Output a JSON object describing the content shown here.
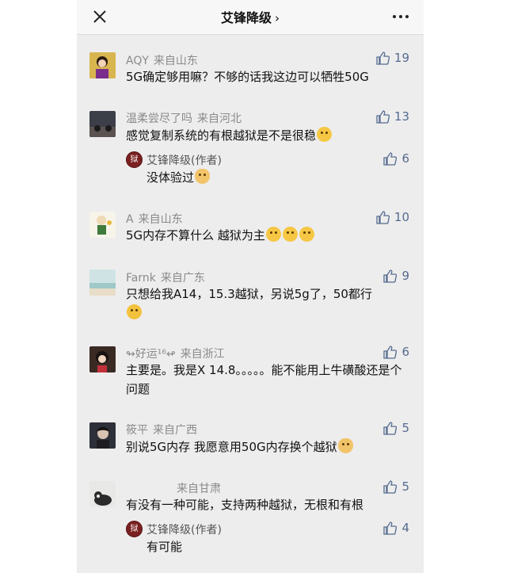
{
  "header": {
    "title": "艾锋降级",
    "chevron": "›"
  },
  "colors": {
    "background": "#ededed",
    "like": "#556b90",
    "meta": "#8a8a8a"
  },
  "comments": [
    {
      "user": "AQY",
      "location": "来自山东",
      "likes": "19",
      "text": "5G确定够用嘛？不够的话我这边可以牺牲50G"
    },
    {
      "user": "温柔尝尽了吗",
      "location": "来自河北",
      "likes": "13",
      "text": "感觉复制系统的有根越狱是不是很稳",
      "reply": {
        "user": "艾锋降级(作者)",
        "likes": "6",
        "text": "没体验过"
      }
    },
    {
      "user": "A",
      "location": "来自山东",
      "likes": "10",
      "text": "5G内存不算什么 越狱为主"
    },
    {
      "user": "Farnk",
      "location": "来自广东",
      "likes": "9",
      "text": "只想给我A14，15.3越狱，另说5g了，50都行"
    },
    {
      "user": "↬好运¹⁶↫",
      "location": "来自浙江",
      "likes": "6",
      "text": "主要是。我是X 14.8。。。。。能不能用上牛磺酸还是个问题"
    },
    {
      "user": "筱平",
      "location": "来自广西",
      "likes": "5",
      "text": "别说5G内存 我愿意用50G内存换个越狱"
    },
    {
      "user": "",
      "location": "来自甘肃",
      "likes": "5",
      "text": "有没有一种可能，支持两种越狱，无根和有根",
      "reply": {
        "user": "艾锋降级(作者)",
        "likes": "4",
        "text": "有可能"
      }
    }
  ],
  "reply_badge": "狱",
  "icons": [
    "close-icon",
    "more-icon",
    "thumbs-up-icon"
  ]
}
